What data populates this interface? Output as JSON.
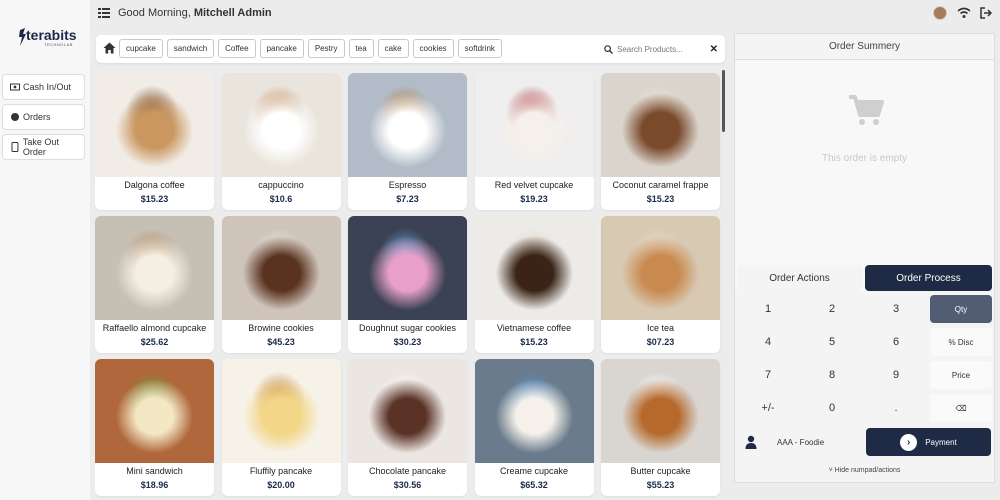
{
  "header": {
    "greeting": "Good Morning,",
    "user": "Mitchell Admin"
  },
  "brand": {
    "name": "terabits",
    "tagline": "TECHNOLAB"
  },
  "sidebar": {
    "items": [
      {
        "label": "Cash In/Out",
        "icon": "cash-icon"
      },
      {
        "label": "Orders",
        "icon": "orders-icon"
      },
      {
        "label": "Take Out Order",
        "icon": "takeout-icon"
      }
    ]
  },
  "categories": [
    "cupcake",
    "sandwich",
    "Coffee",
    "pancake",
    "Pestry",
    "tea",
    "cake",
    "cookies",
    "softdrink"
  ],
  "search": {
    "placeholder": "Search Products..."
  },
  "products": [
    {
      "name": "Dalgona coffee",
      "price": "$15.23",
      "colors": [
        "#f1ece6",
        "#c9975f",
        "#6b3b1c"
      ]
    },
    {
      "name": "cappuccino",
      "price": "$10.6",
      "colors": [
        "#e9e4dc",
        "#ffffff",
        "#c08652"
      ]
    },
    {
      "name": "Espresso",
      "price": "$7.23",
      "colors": [
        "#b2bcc8",
        "#ffffff",
        "#b4773e"
      ]
    },
    {
      "name": "Red velvet cupcake",
      "price": "$19.23",
      "colors": [
        "#efeeee",
        "#f5f0ea",
        "#a6242a"
      ]
    },
    {
      "name": "Coconut caramel frappe",
      "price": "$15.23",
      "colors": [
        "#dad4cc",
        "#7a4a2c",
        "#f2ebe2"
      ]
    },
    {
      "name": "Raffaello almond cupcake",
      "price": "$25.62",
      "colors": [
        "#c6bfb4",
        "#f4eee3",
        "#b2875a"
      ]
    },
    {
      "name": "Browine cookies",
      "price": "$45.23",
      "colors": [
        "#cfc4ba",
        "#5a3320",
        "#f0ebe4"
      ]
    },
    {
      "name": "Doughnut sugar cookies",
      "price": "$30.23",
      "colors": [
        "#3b4253",
        "#e8a0c8",
        "#5bb0e0"
      ]
    },
    {
      "name": "Vietnamese coffee",
      "price": "$15.23",
      "colors": [
        "#ecebe8",
        "#3b2417",
        "#d9cfc2"
      ]
    },
    {
      "name": "Ice tea",
      "price": "$07.23",
      "colors": [
        "#d8c9b3",
        "#c98a4f",
        "#efe3d2"
      ]
    },
    {
      "name": "Mini sandwich",
      "price": "$18.96",
      "colors": [
        "#b0673b",
        "#f3e7c4",
        "#6b9a3b"
      ]
    },
    {
      "name": "Fluffily pancake",
      "price": "$20.00",
      "colors": [
        "#f6f2e8",
        "#f3d688",
        "#c07b2c"
      ]
    },
    {
      "name": "Chocolate pancake",
      "price": "$30.56",
      "colors": [
        "#ebe6e1",
        "#5a3226",
        "#ffffff"
      ]
    },
    {
      "name": "Creame cupcake",
      "price": "$65.32",
      "colors": [
        "#6a7c8c",
        "#f5f1ea",
        "#4d8ed0"
      ]
    },
    {
      "name": "Butter cupcake",
      "price": "$55.23",
      "colors": [
        "#d9d6d2",
        "#b56a2c",
        "#ffffff"
      ]
    }
  ],
  "order": {
    "title": "Order Summery",
    "empty_text": "This order is empty",
    "tabs": [
      "Order Actions",
      "Order Process"
    ],
    "numpad": [
      [
        "1",
        "2",
        "3",
        "Qty"
      ],
      [
        "4",
        "5",
        "6",
        "% Disc"
      ],
      [
        "7",
        "8",
        "9",
        "Price"
      ],
      [
        "+/-",
        "0",
        ".",
        "⌫"
      ]
    ],
    "customer": "AAA - Foodie",
    "payment_label": "Payment",
    "hide_numpad": "Hide numpad/actions"
  },
  "colors": {
    "accent": "#1f2a44",
    "qty_active": "#525d73",
    "price_text": "#1b2a4a"
  }
}
